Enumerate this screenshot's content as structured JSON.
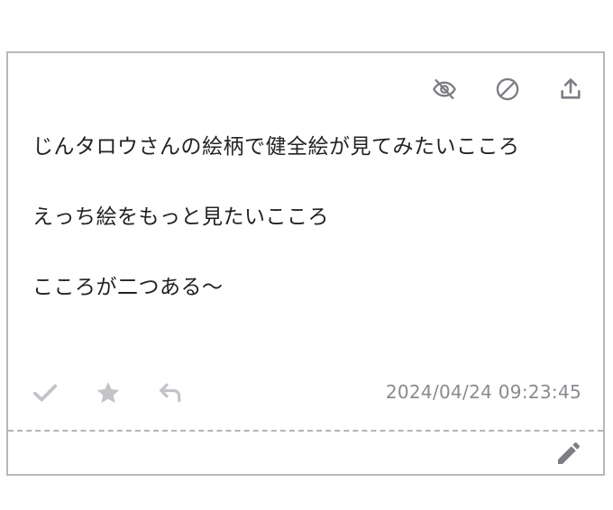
{
  "card": {
    "top_actions": [
      {
        "icon": "eye-off-icon"
      },
      {
        "icon": "block-icon"
      },
      {
        "icon": "share-upload-icon"
      }
    ],
    "message_lines": [
      "じんタロウさんの絵柄で健全絵が見てみたいこころ",
      "えっち絵をもっと見たいこころ",
      "こころが二つある〜"
    ],
    "bottom_actions": [
      {
        "icon": "checkmark-icon"
      },
      {
        "icon": "star-icon"
      },
      {
        "icon": "reply-icon"
      }
    ],
    "timestamp": "2024/04/24 09:23:45",
    "edit_icon": "pencil-icon"
  },
  "colors": {
    "border": "#b7b7bd",
    "icon_dark": "#7d7d84",
    "icon_light": "#c3c3c8",
    "text": "#222222",
    "timestamp": "#8a8a90"
  }
}
